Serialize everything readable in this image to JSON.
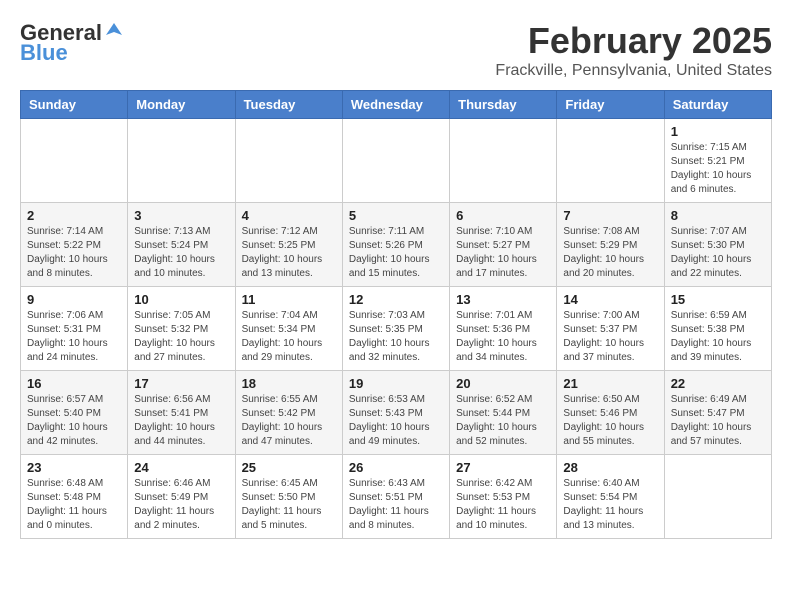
{
  "header": {
    "logo_general": "General",
    "logo_blue": "Blue",
    "title": "February 2025",
    "subtitle": "Frackville, Pennsylvania, United States"
  },
  "days_of_week": [
    "Sunday",
    "Monday",
    "Tuesday",
    "Wednesday",
    "Thursday",
    "Friday",
    "Saturday"
  ],
  "weeks": [
    [
      {
        "day": "",
        "info": ""
      },
      {
        "day": "",
        "info": ""
      },
      {
        "day": "",
        "info": ""
      },
      {
        "day": "",
        "info": ""
      },
      {
        "day": "",
        "info": ""
      },
      {
        "day": "",
        "info": ""
      },
      {
        "day": "1",
        "info": "Sunrise: 7:15 AM\nSunset: 5:21 PM\nDaylight: 10 hours\nand 6 minutes."
      }
    ],
    [
      {
        "day": "2",
        "info": "Sunrise: 7:14 AM\nSunset: 5:22 PM\nDaylight: 10 hours\nand 8 minutes."
      },
      {
        "day": "3",
        "info": "Sunrise: 7:13 AM\nSunset: 5:24 PM\nDaylight: 10 hours\nand 10 minutes."
      },
      {
        "day": "4",
        "info": "Sunrise: 7:12 AM\nSunset: 5:25 PM\nDaylight: 10 hours\nand 13 minutes."
      },
      {
        "day": "5",
        "info": "Sunrise: 7:11 AM\nSunset: 5:26 PM\nDaylight: 10 hours\nand 15 minutes."
      },
      {
        "day": "6",
        "info": "Sunrise: 7:10 AM\nSunset: 5:27 PM\nDaylight: 10 hours\nand 17 minutes."
      },
      {
        "day": "7",
        "info": "Sunrise: 7:08 AM\nSunset: 5:29 PM\nDaylight: 10 hours\nand 20 minutes."
      },
      {
        "day": "8",
        "info": "Sunrise: 7:07 AM\nSunset: 5:30 PM\nDaylight: 10 hours\nand 22 minutes."
      }
    ],
    [
      {
        "day": "9",
        "info": "Sunrise: 7:06 AM\nSunset: 5:31 PM\nDaylight: 10 hours\nand 24 minutes."
      },
      {
        "day": "10",
        "info": "Sunrise: 7:05 AM\nSunset: 5:32 PM\nDaylight: 10 hours\nand 27 minutes."
      },
      {
        "day": "11",
        "info": "Sunrise: 7:04 AM\nSunset: 5:34 PM\nDaylight: 10 hours\nand 29 minutes."
      },
      {
        "day": "12",
        "info": "Sunrise: 7:03 AM\nSunset: 5:35 PM\nDaylight: 10 hours\nand 32 minutes."
      },
      {
        "day": "13",
        "info": "Sunrise: 7:01 AM\nSunset: 5:36 PM\nDaylight: 10 hours\nand 34 minutes."
      },
      {
        "day": "14",
        "info": "Sunrise: 7:00 AM\nSunset: 5:37 PM\nDaylight: 10 hours\nand 37 minutes."
      },
      {
        "day": "15",
        "info": "Sunrise: 6:59 AM\nSunset: 5:38 PM\nDaylight: 10 hours\nand 39 minutes."
      }
    ],
    [
      {
        "day": "16",
        "info": "Sunrise: 6:57 AM\nSunset: 5:40 PM\nDaylight: 10 hours\nand 42 minutes."
      },
      {
        "day": "17",
        "info": "Sunrise: 6:56 AM\nSunset: 5:41 PM\nDaylight: 10 hours\nand 44 minutes."
      },
      {
        "day": "18",
        "info": "Sunrise: 6:55 AM\nSunset: 5:42 PM\nDaylight: 10 hours\nand 47 minutes."
      },
      {
        "day": "19",
        "info": "Sunrise: 6:53 AM\nSunset: 5:43 PM\nDaylight: 10 hours\nand 49 minutes."
      },
      {
        "day": "20",
        "info": "Sunrise: 6:52 AM\nSunset: 5:44 PM\nDaylight: 10 hours\nand 52 minutes."
      },
      {
        "day": "21",
        "info": "Sunrise: 6:50 AM\nSunset: 5:46 PM\nDaylight: 10 hours\nand 55 minutes."
      },
      {
        "day": "22",
        "info": "Sunrise: 6:49 AM\nSunset: 5:47 PM\nDaylight: 10 hours\nand 57 minutes."
      }
    ],
    [
      {
        "day": "23",
        "info": "Sunrise: 6:48 AM\nSunset: 5:48 PM\nDaylight: 11 hours\nand 0 minutes."
      },
      {
        "day": "24",
        "info": "Sunrise: 6:46 AM\nSunset: 5:49 PM\nDaylight: 11 hours\nand 2 minutes."
      },
      {
        "day": "25",
        "info": "Sunrise: 6:45 AM\nSunset: 5:50 PM\nDaylight: 11 hours\nand 5 minutes."
      },
      {
        "day": "26",
        "info": "Sunrise: 6:43 AM\nSunset: 5:51 PM\nDaylight: 11 hours\nand 8 minutes."
      },
      {
        "day": "27",
        "info": "Sunrise: 6:42 AM\nSunset: 5:53 PM\nDaylight: 11 hours\nand 10 minutes."
      },
      {
        "day": "28",
        "info": "Sunrise: 6:40 AM\nSunset: 5:54 PM\nDaylight: 11 hours\nand 13 minutes."
      },
      {
        "day": "",
        "info": ""
      }
    ]
  ]
}
